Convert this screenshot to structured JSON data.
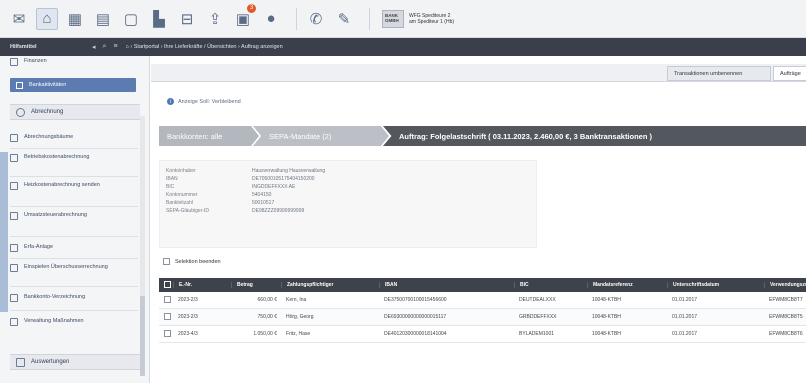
{
  "toolbar": {
    "icons": [
      "mail-icon",
      "home-icon",
      "calendar-icon",
      "grid-icon",
      "document-icon",
      "chart-icon",
      "table-icon",
      "upload-icon",
      "bank-transfer-icon",
      "globe-icon",
      "phone-icon",
      "edit-icon"
    ],
    "badge": "3",
    "bank_logo": "BANK GMBH",
    "bank_line1": "WFG Spediteure 2",
    "bank_line2": "am Spediteur 1 (Hb)"
  },
  "nav": {
    "title": "Hilfsmittel",
    "breadcrumb": "⌂ › Startportal › Ihre Lieferkräfte / Übersichten › Auftrag anzeigen"
  },
  "sidebar": {
    "top_item": "Finanzen",
    "selected": "Bankaktivitäten",
    "section": "Abrechnung",
    "items": [
      "Abrechnungsbäume",
      "Betriebskostenabrechnung",
      "Heizkostenabrechnung senden",
      "Umsatzsteuerabrechnung",
      "Erfa-Anlage",
      "Einspielen Überschusserrechnung",
      "Bankkonto-Verzeichnung",
      "Verwaltung Maßnahmen"
    ],
    "footer": "Auswertungen"
  },
  "main": {
    "tab_left": "Transaktionen umbenennen",
    "tab_right": "Aufträge",
    "info": "Anzeige Soll: Verbleibend",
    "steps": {
      "s1": "Bankkonten: alle",
      "s2": "SEPA-Mandate (2)",
      "s3": "Auftrag: Folgelastschrift ( 03.11.2023, 2.460,00 €, 3 Banktransaktionen )"
    },
    "detail": [
      {
        "k": "Kontoinhaber",
        "v": "Hausverwaltung Hausverwaltung"
      },
      {
        "k": "IBAN",
        "v": "DE70500105175404150200"
      },
      {
        "k": "BIC",
        "v": "INGDDEFFXXX AE"
      },
      {
        "k": "Kontonummer",
        "v": "5404150"
      },
      {
        "k": "Bankleitzahl",
        "v": "50010517"
      },
      {
        "k": "SEPA-Gläubiger-ID",
        "v": "DE98ZZZ09999999999"
      }
    ],
    "check_label": "Selektion beenden"
  },
  "table": {
    "headers": [
      "",
      "E.-Nr.",
      "Betrag",
      "Zahlungspflichtiger",
      "IBAN",
      "BIC",
      "Mandatsreferenz",
      "Unterschriftsdatum",
      "Verwendungszweck"
    ],
    "rows": [
      [
        "",
        "2023-2/3",
        "660,00 €",
        "Kern, Ina",
        "DE37500700100015456600",
        "DEUTDEALXXX",
        "10048-KTBH",
        "01.01.2017",
        "EFWM8CB8T7"
      ],
      [
        "",
        "2023-2/3",
        "750,00 €",
        "Hörg, Georg",
        "DE69300000000000015117",
        "GRBDDEFFXXX",
        "10048-KTBH",
        "01.01.2017",
        "EFWM8CB8T5"
      ],
      [
        "",
        "2023-4/3",
        "1.050,00 €",
        "Fritz, Hase",
        "DE40120300000018141004",
        "BYLADEM1001",
        "10048-KTBH",
        "01.01.2017",
        "EFWM8CB8T6"
      ]
    ]
  },
  "colors": {
    "accent": "#5c7bb0",
    "nav_bg": "#3a3f4b",
    "step_active": "#53585f",
    "table_header": "#3d424b"
  }
}
